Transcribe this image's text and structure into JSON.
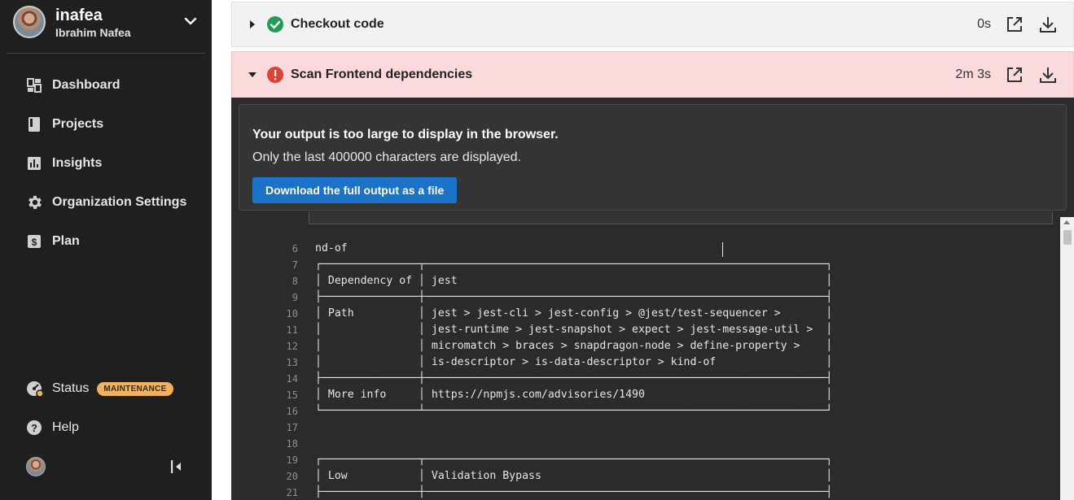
{
  "org": {
    "name": "inafea",
    "user": "Ibrahim Nafea"
  },
  "nav": [
    {
      "label": "Dashboard",
      "icon": "dashboard-icon"
    },
    {
      "label": "Projects",
      "icon": "projects-icon"
    },
    {
      "label": "Insights",
      "icon": "insights-icon"
    },
    {
      "label": "Organization Settings",
      "icon": "gear-icon"
    },
    {
      "label": "Plan",
      "icon": "plan-icon"
    }
  ],
  "bottom_nav": {
    "status": {
      "label": "Status",
      "badge": "MAINTENANCE"
    },
    "help": {
      "label": "Help"
    }
  },
  "steps": [
    {
      "title": "Checkout code",
      "duration": "0s",
      "status": "success",
      "expanded": false
    },
    {
      "title": "Scan Frontend dependencies",
      "duration": "2m 3s",
      "status": "failed",
      "expanded": true
    }
  ],
  "notice": {
    "title": "Your output is too large to display in the browser.",
    "text": "Only the last 400000 characters are displayed.",
    "button": "Download the full output as a file"
  },
  "code_lines": [
    {
      "n": "6",
      "text": "nd-of"
    },
    {
      "n": "7",
      "text": "┌───────────────┬──────────────────────────────────────────────────────────────┐"
    },
    {
      "n": "8",
      "text": "│ Dependency of │ jest                                                         │"
    },
    {
      "n": "9",
      "text": "├───────────────┼──────────────────────────────────────────────────────────────┤"
    },
    {
      "n": "10",
      "text": "│ Path          │ jest > jest-cli > jest-config > @jest/test-sequencer >       │"
    },
    {
      "n": "11",
      "text": "│               │ jest-runtime > jest-snapshot > expect > jest-message-util >  │"
    },
    {
      "n": "12",
      "text": "│               │ micromatch > braces > snapdragon-node > define-property >    │"
    },
    {
      "n": "13",
      "text": "│               │ is-descriptor > is-data-descriptor > kind-of                 │"
    },
    {
      "n": "14",
      "text": "├───────────────┼──────────────────────────────────────────────────────────────┤"
    },
    {
      "n": "15",
      "text": "│ More info     │ https://npmjs.com/advisories/1490                            │"
    },
    {
      "n": "16",
      "text": "└───────────────┴──────────────────────────────────────────────────────────────┘"
    },
    {
      "n": "17",
      "text": ""
    },
    {
      "n": "18",
      "text": ""
    },
    {
      "n": "19",
      "text": "┌───────────────┬──────────────────────────────────────────────────────────────┐"
    },
    {
      "n": "20",
      "text": "│ Low           │ Validation Bypass                                            │"
    },
    {
      "n": "21",
      "text": "├───────────────┼──────────────────────────────────────────────────────────────┤"
    }
  ],
  "colors": {
    "sidebar_bg": "#1f1f1f",
    "success": "#1f9d55",
    "error": "#e0403a",
    "failed_step_bg": "#fadada",
    "button_blue": "#1a73c8",
    "badge": "#f3b15a"
  }
}
